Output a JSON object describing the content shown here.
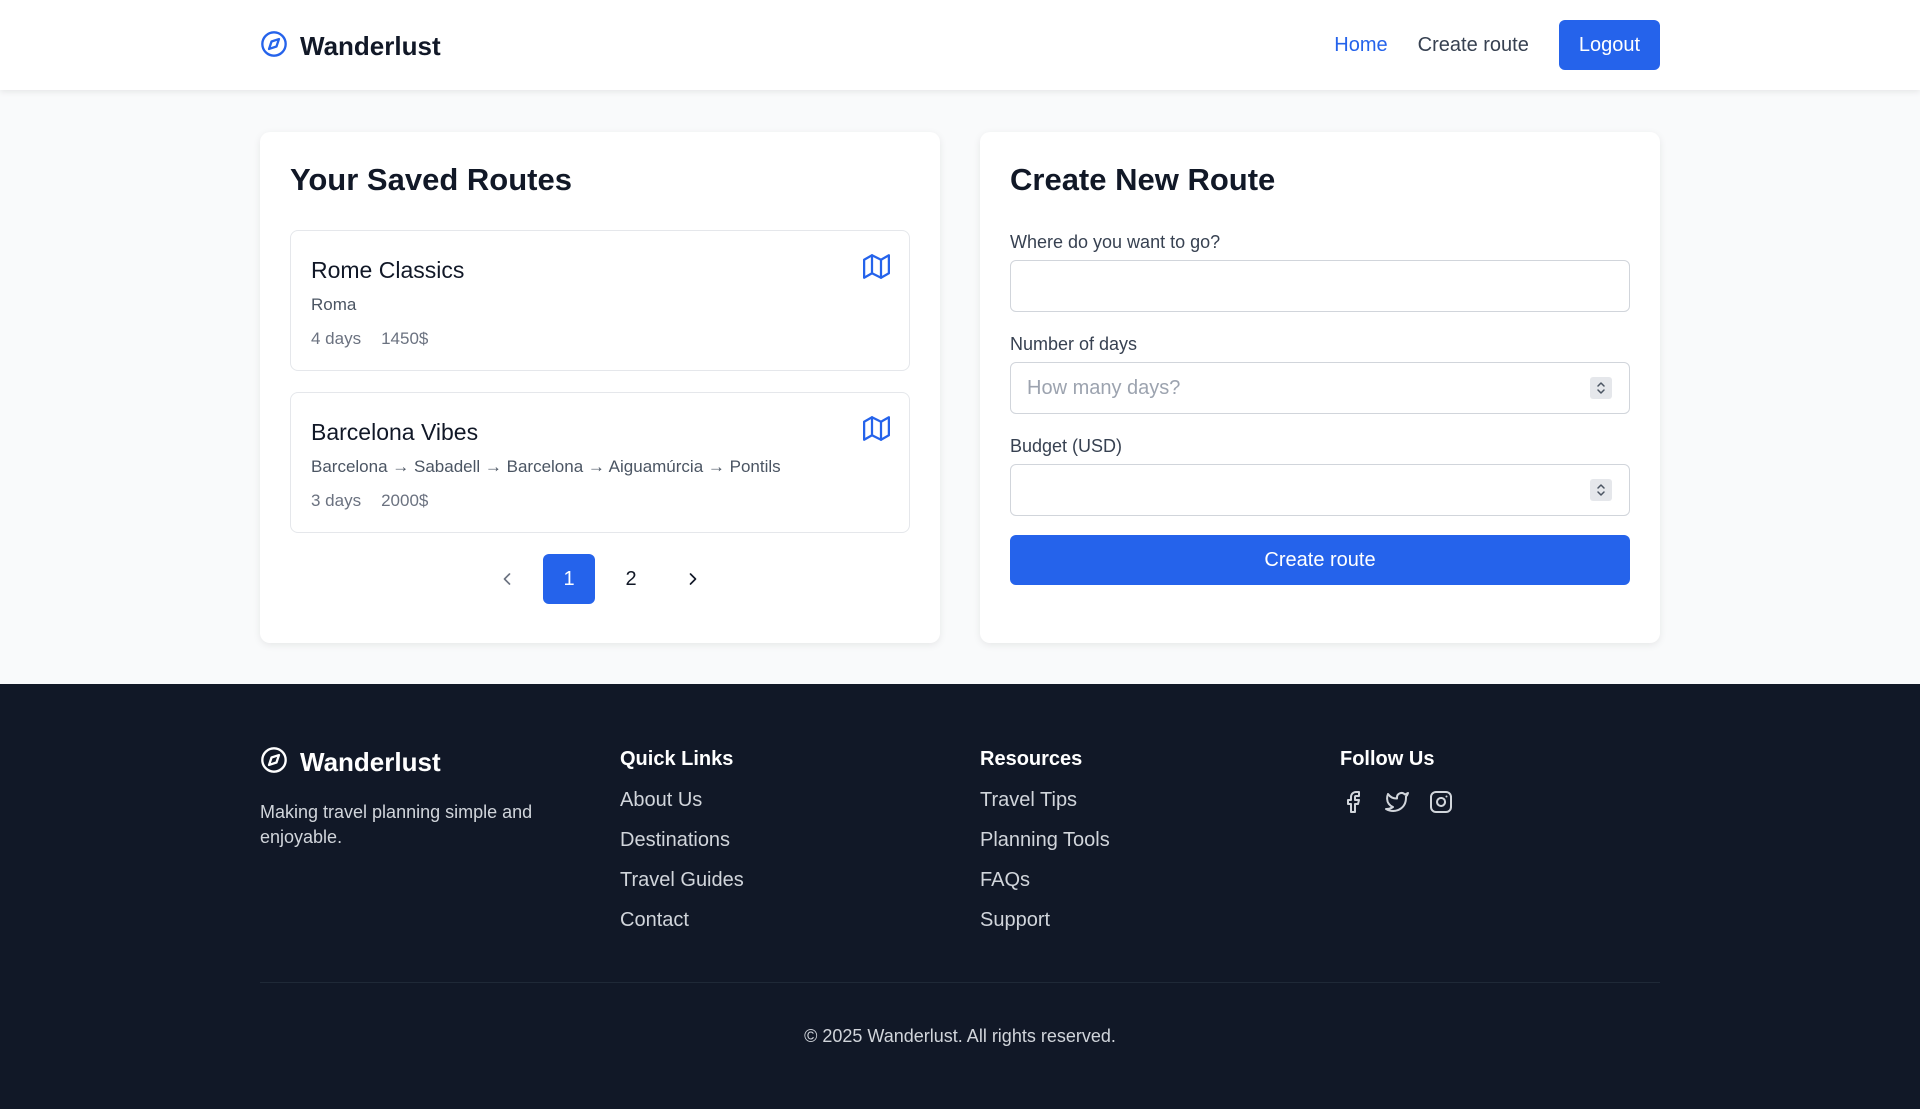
{
  "header": {
    "brand_name": "Wanderlust",
    "nav": {
      "home": "Home",
      "create_route": "Create route"
    },
    "logout_label": "Logout"
  },
  "saved_routes": {
    "title": "Your Saved Routes",
    "items": [
      {
        "name": "Rome Classics",
        "places": "Roma",
        "days": "4 days",
        "budget": "1450$"
      },
      {
        "name": "Barcelona Vibes",
        "places": "Barcelona → Sabadell → Barcelona → Aiguamúrcia → Pontils",
        "days": "3 days",
        "budget": "2000$"
      }
    ],
    "pagination": {
      "pages": [
        "1",
        "2"
      ],
      "current": "1"
    }
  },
  "create_route": {
    "title": "Create New Route",
    "destination": {
      "label": "Where do you want to go?",
      "value": "",
      "placeholder": ""
    },
    "days": {
      "label": "Number of days",
      "value": "",
      "placeholder": "How many days?"
    },
    "budget": {
      "label": "Budget (USD)",
      "value": "",
      "placeholder": ""
    },
    "submit_label": "Create route"
  },
  "footer": {
    "brand_name": "Wanderlust",
    "tagline": "Making travel planning simple and enjoyable.",
    "quick_links": {
      "title": "Quick Links",
      "items": [
        "About Us",
        "Destinations",
        "Travel Guides",
        "Contact"
      ]
    },
    "resources": {
      "title": "Resources",
      "items": [
        "Travel Tips",
        "Planning Tools",
        "FAQs",
        "Support"
      ]
    },
    "follow": {
      "title": "Follow Us",
      "icons": [
        "facebook-icon",
        "twitter-icon",
        "instagram-icon"
      ]
    },
    "copyright": "© 2025 Wanderlust. All rights reserved."
  },
  "colors": {
    "accent": "#2563eb",
    "footer_bg": "#111827",
    "page_bg": "#f9fafb"
  }
}
